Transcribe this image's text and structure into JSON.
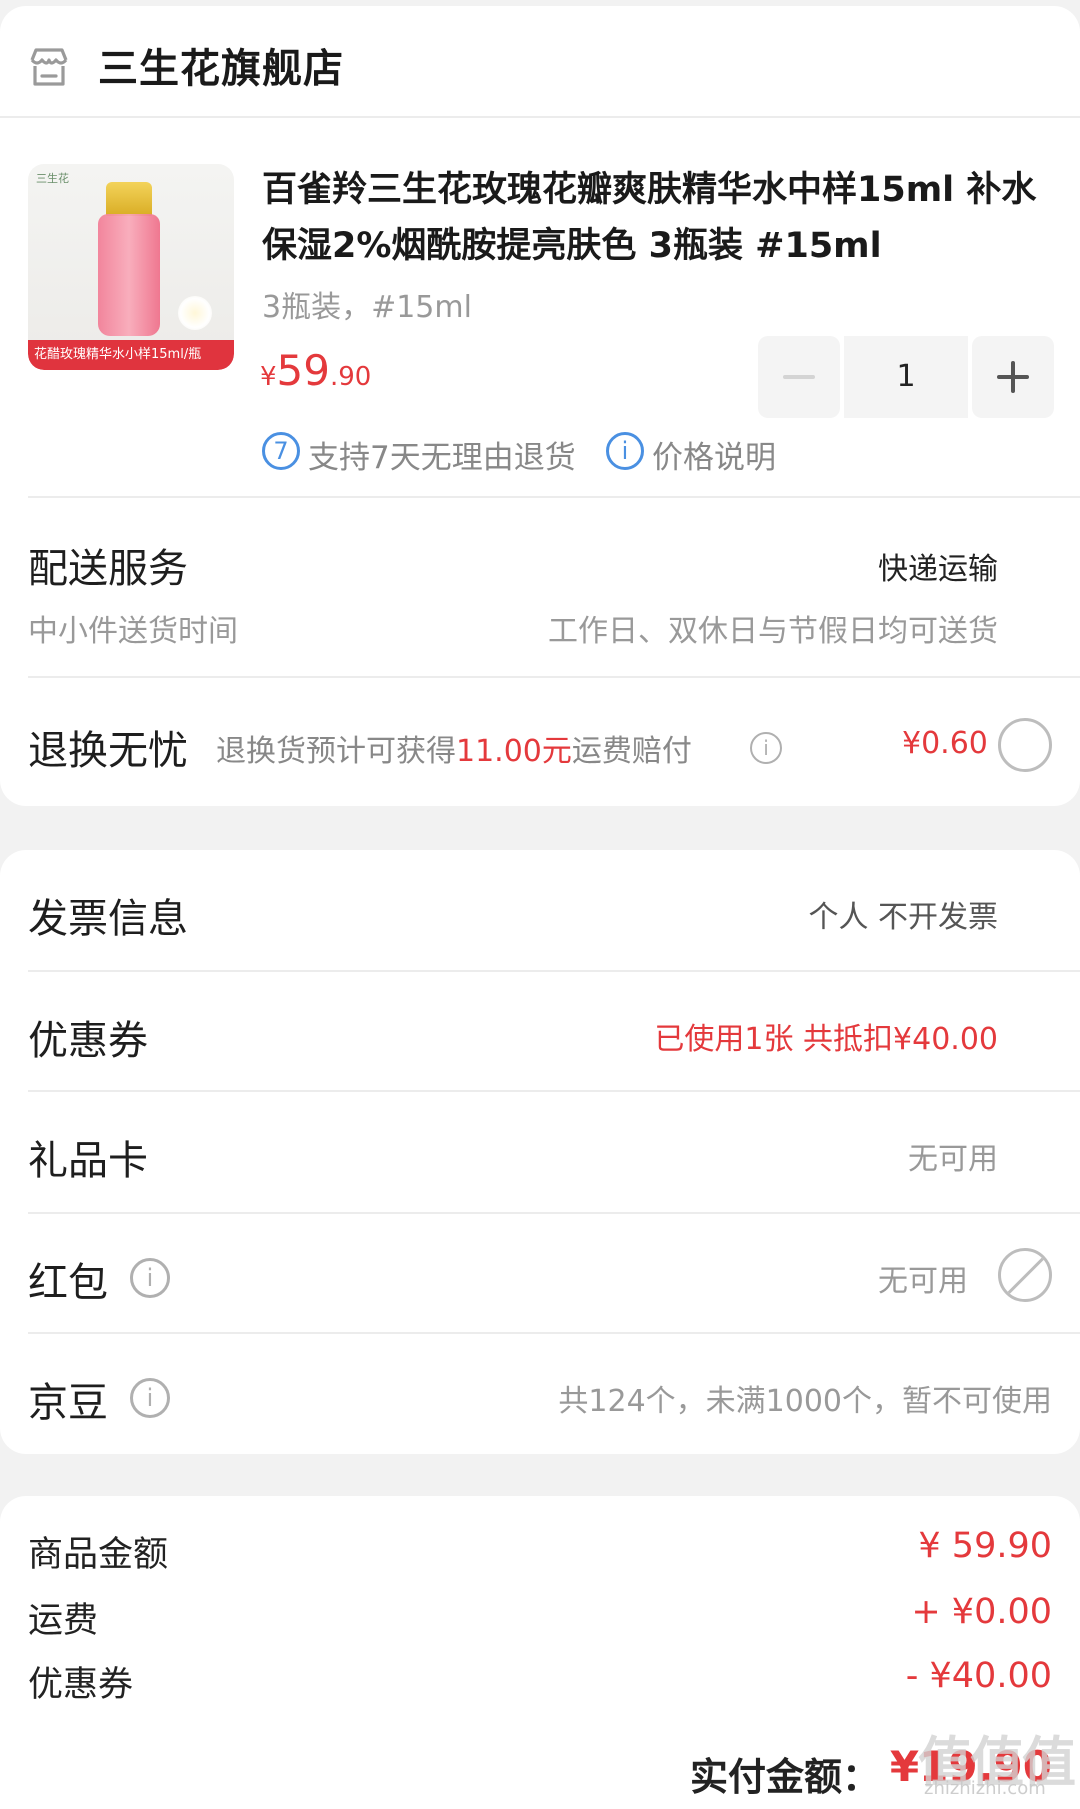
{
  "store": {
    "name": "三生花旗舰店",
    "icon": "store-icon"
  },
  "product": {
    "thumb_brand": "三生花",
    "thumb_banner": "花醋玫瑰精华水小样15ml/瓶",
    "title": "百雀羚三生花玫瑰花瓣爽肤精华水中样15ml 补水保湿2%烟酰胺提亮肤色 3瓶装 #15ml",
    "variant": "3瓶装，#15ml",
    "price": {
      "currency": "¥",
      "integer": "59",
      "decimal": ".90"
    },
    "quantity": "1",
    "services": [
      {
        "icon_text": "7",
        "label": "支持7天无理由退货"
      },
      {
        "icon_text": "i",
        "label": "价格说明"
      }
    ]
  },
  "delivery": {
    "title": "配送服务",
    "method": "快递运输",
    "sub_label": "中小件送货时间",
    "sub_value": "工作日、双休日与节假日均可送货"
  },
  "return_worry_free": {
    "title": "退换无忧",
    "desc_prefix": "退换货预计可获得",
    "desc_amount": "11.00元",
    "desc_suffix": "运费赔付",
    "price": "¥0.60"
  },
  "invoice": {
    "title": "发票信息",
    "value": "个人 不开发票"
  },
  "coupon": {
    "title": "优惠券",
    "value": "已使用1张 共抵扣¥40.00"
  },
  "gift_card": {
    "title": "礼品卡",
    "value": "无可用"
  },
  "red_packet": {
    "title": "红包",
    "value": "无可用"
  },
  "jingdou": {
    "title": "京豆",
    "value": "共124个，未满1000个，暂不可使用"
  },
  "summary": {
    "rows": [
      {
        "label": "商品金额",
        "value": "¥ 59.90"
      },
      {
        "label": "运费",
        "value": "+ ¥0.00"
      },
      {
        "label": "优惠券",
        "value": "- ¥40.00"
      }
    ],
    "total_label": "实付金额：",
    "total_value": "¥19.90"
  },
  "watermark": {
    "text": "值值值",
    "sub": "zhizhizhi.com"
  },
  "colors": {
    "accent_red": "#e4393c",
    "info_blue": "#4a90e2",
    "background": "#f2f2f2"
  }
}
